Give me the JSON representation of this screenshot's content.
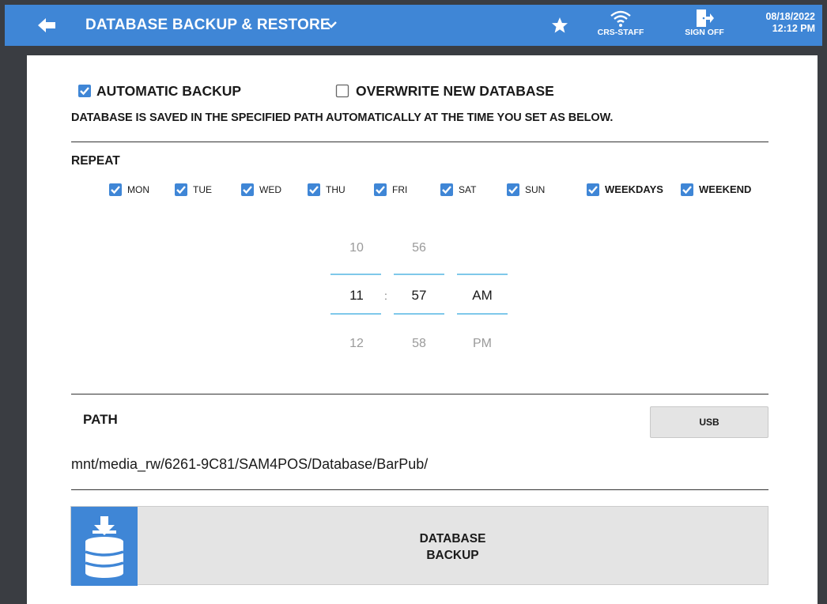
{
  "header": {
    "title": "DATABASE BACKUP & RESTORE",
    "wifi_label": "CRS-STAFF",
    "signoff_label": "SIGN OFF",
    "date": "08/18/2022",
    "time": "12:12 PM",
    "accent_color": "#3f86d6"
  },
  "options": {
    "automatic_backup": {
      "label": "AUTOMATIC BACKUP",
      "checked": true
    },
    "overwrite": {
      "label": "OVERWRITE NEW DATABASE",
      "checked": false
    },
    "description": "DATABASE IS SAVED IN THE SPECIFIED PATH AUTOMATICALLY AT THE TIME YOU SET AS BELOW."
  },
  "repeat": {
    "label": "REPEAT",
    "days": [
      {
        "label": "MON",
        "checked": true
      },
      {
        "label": "TUE",
        "checked": true
      },
      {
        "label": "WED",
        "checked": true
      },
      {
        "label": "THU",
        "checked": true
      },
      {
        "label": "FRI",
        "checked": true
      },
      {
        "label": "SAT",
        "checked": true
      },
      {
        "label": "SUN",
        "checked": true
      },
      {
        "label": "WEEKDAYS",
        "checked": true
      },
      {
        "label": "WEEKEND",
        "checked": true
      }
    ]
  },
  "time_picker": {
    "hour": {
      "prev": "10",
      "current": "11",
      "next": "12"
    },
    "minute": {
      "prev": "56",
      "current": "57",
      "next": "58"
    },
    "ampm": {
      "prev": "",
      "current": "AM",
      "next": "PM"
    },
    "separator": ":"
  },
  "path": {
    "label": "PATH",
    "usb_button": "USB",
    "value": "mnt/media_rw/6261-9C81/SAM4POS/Database/BarPub/"
  },
  "backup_button": {
    "line1": "DATABASE",
    "line2": "BACKUP"
  }
}
